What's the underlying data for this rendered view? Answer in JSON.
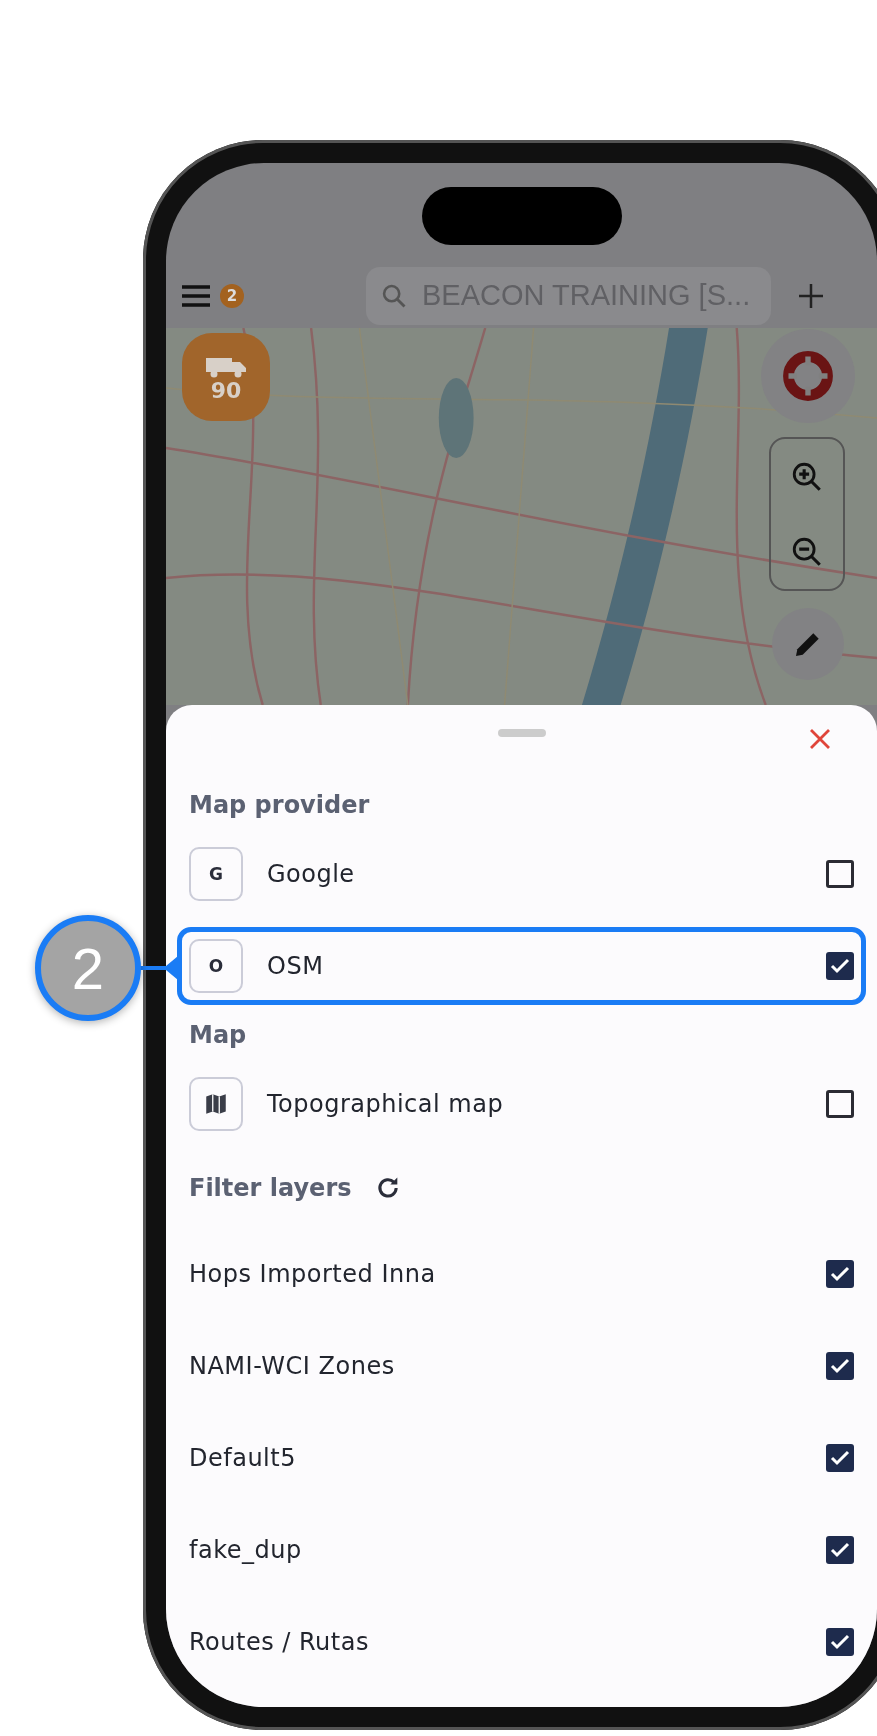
{
  "top_bar": {
    "notification_count": "2",
    "search": {
      "value": "BEACON TRAINING [S..."
    }
  },
  "map": {
    "vehicle_badge": {
      "count": "90"
    }
  },
  "sheet": {
    "sections": [
      {
        "title": "Map provider",
        "refresh": false,
        "items": [
          {
            "kind": "provider",
            "icon_letter": "G",
            "label": "Google",
            "checked": false,
            "highlighted": false
          },
          {
            "kind": "provider",
            "icon_letter": "O",
            "label": "OSM",
            "checked": true,
            "highlighted": true
          }
        ]
      },
      {
        "title": "Map",
        "refresh": false,
        "items": [
          {
            "kind": "map",
            "label": "Topographical map",
            "checked": false,
            "highlighted": false
          }
        ]
      },
      {
        "title": "Filter layers",
        "refresh": true,
        "items": [
          {
            "kind": "layer",
            "label": "Hops Imported Inna",
            "checked": true,
            "highlighted": false
          },
          {
            "kind": "layer",
            "label": "NAMI-WCI Zones",
            "checked": true,
            "highlighted": false
          },
          {
            "kind": "layer",
            "label": "Default5",
            "checked": true,
            "highlighted": false
          },
          {
            "kind": "layer",
            "label": "fake_dup",
            "checked": true,
            "highlighted": false
          },
          {
            "kind": "layer",
            "label": "Routes / Rutas",
            "checked": true,
            "highlighted": false
          }
        ]
      }
    ]
  },
  "callout": {
    "number": "2"
  }
}
